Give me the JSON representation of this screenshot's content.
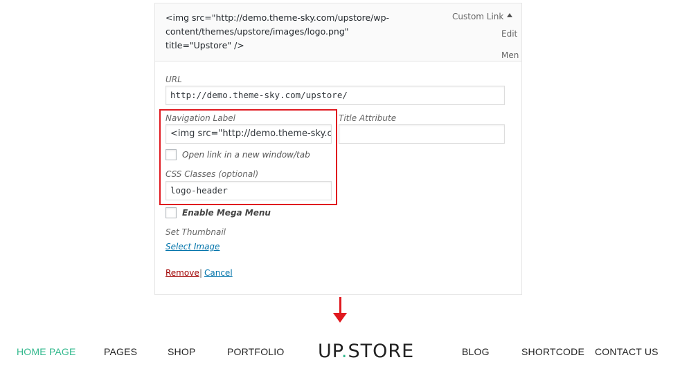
{
  "menu_item": {
    "title": "<img src=\"http://demo.theme-sky.com/upstore/wp-content/themes/upstore/images/logo.png\" title=\"Upstore\" />",
    "type": "Custom Link",
    "edit_label": "Edit",
    "men_label": "Men",
    "url_label": "URL",
    "url_value": "http://demo.theme-sky.com/upstore/",
    "nav_label_label": "Navigation Label",
    "nav_label_value": "<img src=\"http://demo.theme-sky.cc",
    "title_attr_label": "Title Attribute",
    "title_attr_value": "",
    "new_window_label": "Open link in a new window/tab",
    "css_label": "CSS Classes (optional)",
    "css_value": "logo-header",
    "mega_menu_label": "Enable Mega Menu",
    "thumb_label": "Set Thumbnail",
    "select_image_label": "Select Image",
    "remove_label": "Remove",
    "separator": "|",
    "cancel_label": "Cancel"
  },
  "nav": {
    "items": [
      "HOME PAGE",
      "PAGES",
      "SHOP",
      "PORTFOLIO",
      "BLOG",
      "SHORTCODE",
      "CONTACT US"
    ],
    "logo_left": "UP",
    "logo_dot": ".",
    "logo_right": "STORE"
  },
  "colors": {
    "highlight": "#e0191f",
    "accent": "#32b88d",
    "link": "#0073aa",
    "remove": "#a00000"
  },
  "icons": {
    "toggle": "triangle-up-icon",
    "arrow": "down-arrow-icon"
  }
}
